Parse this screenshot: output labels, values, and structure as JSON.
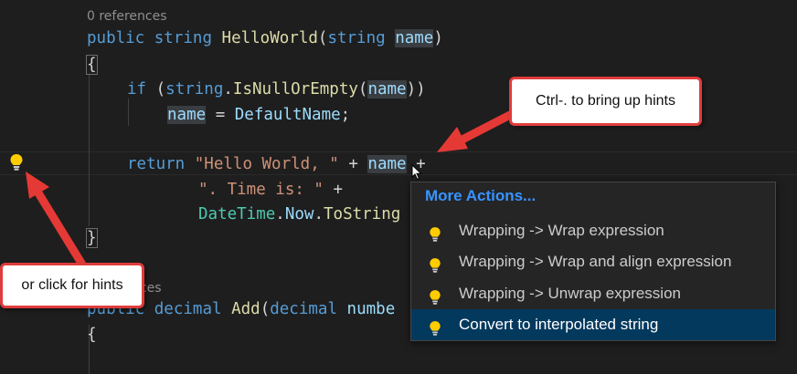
{
  "editor": {
    "codelens_top": "0 references",
    "codelens_bottom": "rences",
    "lines": {
      "l1": {
        "kw1": "public",
        "kw2": "string",
        "fn": "HelloWorld",
        "p1": "(",
        "kw3": "string",
        "param": "name",
        "p2": ")"
      },
      "l2": {
        "brace": "{"
      },
      "l3": {
        "kw": "if",
        "p1": " (",
        "kw2": "string",
        "dot": ".",
        "fn": "IsNullOrEmpty",
        "p2": "(",
        "var": "name",
        "p3": "))"
      },
      "l4": {
        "var": "name",
        "op": " = ",
        "prop": "DefaultName",
        "end": ";"
      },
      "l5": {
        "kw": "return",
        "sp": " ",
        "str": "\"Hello World, \"",
        "op": " + ",
        "var": "name",
        "op2": " +"
      },
      "l6": {
        "str": "\". Time is: \"",
        "op": " +"
      },
      "l7": {
        "ty": "DateTime",
        "dot": ".",
        "prop": "Now",
        "dot2": ".",
        "fn": "ToString"
      },
      "l8": {
        "brace": "}"
      },
      "l9": {
        "kw1": "public",
        "kw2": "decimal",
        "fn": "Add",
        "p1": "(",
        "kw3": "decimal",
        "param": "numbe"
      },
      "l10": {
        "brace": "{"
      }
    }
  },
  "callouts": {
    "top": "Ctrl-. to bring up hints",
    "left": "or click for hints"
  },
  "popup": {
    "header": "More Actions...",
    "items": [
      {
        "label": "Wrapping -> Wrap expression",
        "icon": "lightbulb-icon"
      },
      {
        "label": "Wrapping -> Wrap and align expression",
        "icon": "lightbulb-icon"
      },
      {
        "label": "Wrapping -> Unwrap expression",
        "icon": "lightbulb-icon"
      },
      {
        "label": "Convert to interpolated string",
        "icon": "lightbulb-icon",
        "selected": true
      }
    ]
  },
  "colors": {
    "keyword": "#569cd6",
    "function": "#dcdcaa",
    "type": "#4ec9b0",
    "variable": "#9cdcfe",
    "string": "#ce9178",
    "bulb": "#ffcc00",
    "callout_border": "#e03c3c",
    "popup_header": "#3794ff",
    "selected_bg": "#04395e"
  }
}
